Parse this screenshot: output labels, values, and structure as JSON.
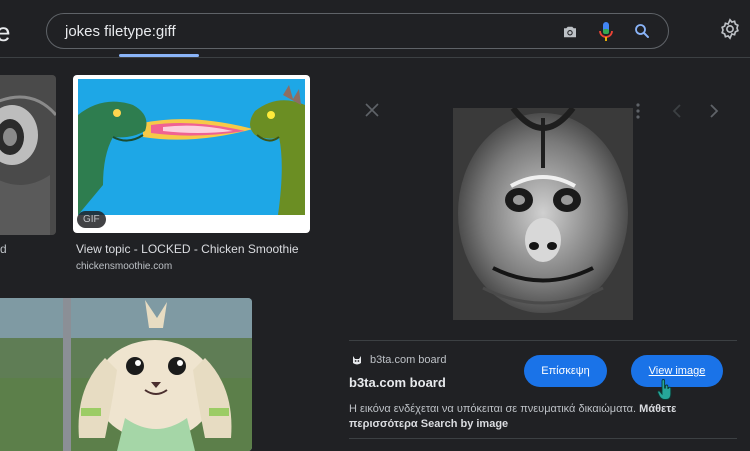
{
  "header": {
    "logo_fragment": "e",
    "search_query": "jokes filetype:giff"
  },
  "results": {
    "left_cut_label": "d",
    "dragon_item": {
      "badge": "GIF",
      "title": "View topic - LOCKED - Chicken Smoothie",
      "site": "chickensmoothie.com"
    }
  },
  "preview": {
    "site_name": "b3ta.com board",
    "title": "b3ta.com board",
    "visit_button": "Επίσκεψη",
    "view_image_button": "View image",
    "notice_text": "Η εικόνα ενδέχεται να υπόκειται σε πνευματικά δικαιώματα.",
    "notice_link": "Μάθετε περισσότερα",
    "search_by_image_link": "Search by image"
  },
  "colors": {
    "background": "#202124",
    "accent_blue": "#1a73e8",
    "tab_underline": "#8ab4f8"
  }
}
